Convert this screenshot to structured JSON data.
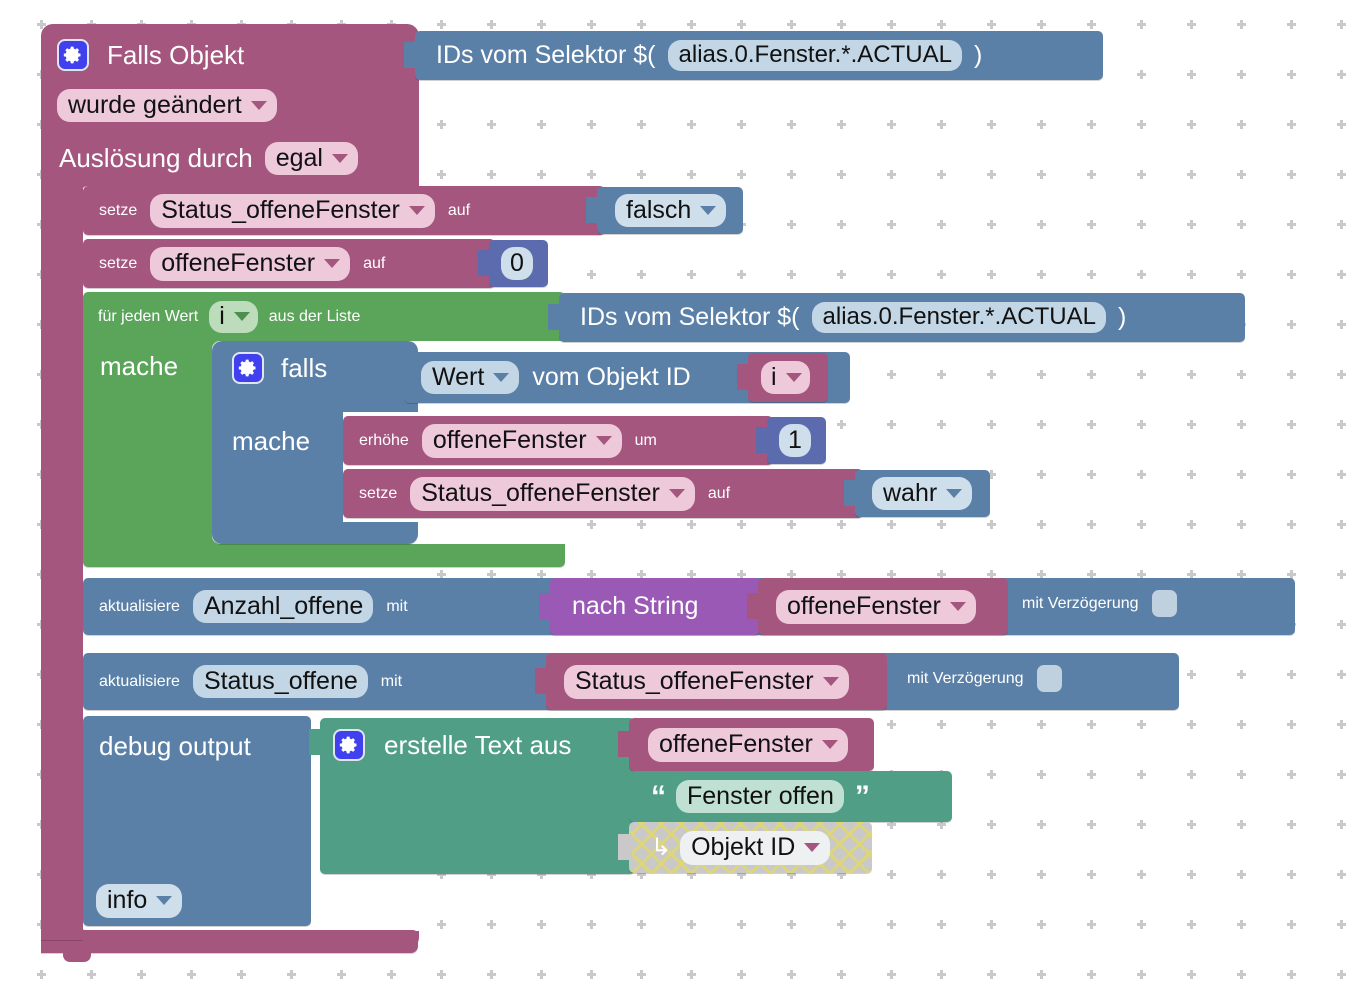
{
  "editor": {
    "name": "blockly-workspace",
    "language": "de",
    "background": "#ffffff",
    "grid_color": "#c9c9c9"
  },
  "colors": {
    "event_pink": "#a4567e",
    "variable_pink": "#a4567e",
    "control_blue": "#5b80a8",
    "loop_green": "#5ba55b",
    "text_teal": "#4f9e85",
    "convert_purple": "#9b59b6",
    "math_navy": "#5b6bad",
    "disabled_gray": "#c9c9c9",
    "mutator_icon": "#4040ef"
  },
  "blocks": {
    "trigger": {
      "icon": "gear-icon",
      "label": "Falls Objekt",
      "selector_value": "alias.0.Fenster.*.ACTUAL",
      "condition_dropdown": "wurde geändert",
      "trigger_by_label": "Auslösung durch",
      "trigger_by_dropdown": "egal"
    },
    "selector_block": {
      "prefix": "IDs vom Selektor $(",
      "value": "alias.0.Fenster.*.ACTUAL",
      "suffix": ")"
    },
    "set_status": {
      "keyword": "setze",
      "variable": "Status_offeneFenster",
      "connector": "auf",
      "value_dropdown": "falsch"
    },
    "set_counter": {
      "keyword": "setze",
      "variable": "offeneFenster",
      "connector": "auf",
      "value_number": "0"
    },
    "for_each": {
      "prefix": "für jeden Wert",
      "variable": "i",
      "middle": "aus der Liste",
      "do_label": "mache",
      "list_prefix": "IDs vom Selektor $(",
      "list_value": "alias.0.Fenster.*.ACTUAL",
      "list_suffix": ")"
    },
    "if_block": {
      "icon": "gear-icon",
      "label": "falls",
      "do_label": "mache",
      "condition": {
        "dropdown": "Wert",
        "middle": "vom Objekt ID",
        "object_var": "i"
      }
    },
    "increment": {
      "keyword": "erhöhe",
      "variable": "offeneFenster",
      "connector": "um",
      "value_number": "1"
    },
    "set_status_true": {
      "keyword": "setze",
      "variable": "Status_offeneFenster",
      "connector": "auf",
      "value_dropdown": "wahr"
    },
    "update_count": {
      "keyword": "aktualisiere",
      "target": "Anzahl_offene",
      "connector": "mit",
      "convert_label": "nach String",
      "convert_variable": "offeneFenster",
      "delay_label": "mit Verzögerung",
      "delay_checked": false
    },
    "update_status": {
      "keyword": "aktualisiere",
      "target": "Status_offene",
      "connector": "mit",
      "variable": "Status_offeneFenster",
      "delay_label": "mit Verzögerung",
      "delay_checked": false
    },
    "debug_output": {
      "label": "debug output",
      "level_dropdown": "info",
      "create_text": {
        "icon": "gear-icon",
        "label": "erstelle Text aus",
        "items": [
          {
            "kind": "variable",
            "value": "offeneFenster"
          },
          {
            "kind": "string",
            "value": "Fenster offen",
            "open_quote": "“",
            "close_quote": "”"
          },
          {
            "kind": "disabled-dropdown",
            "value": "Objekt ID",
            "icon": "return-arrow-icon"
          }
        ]
      }
    }
  }
}
